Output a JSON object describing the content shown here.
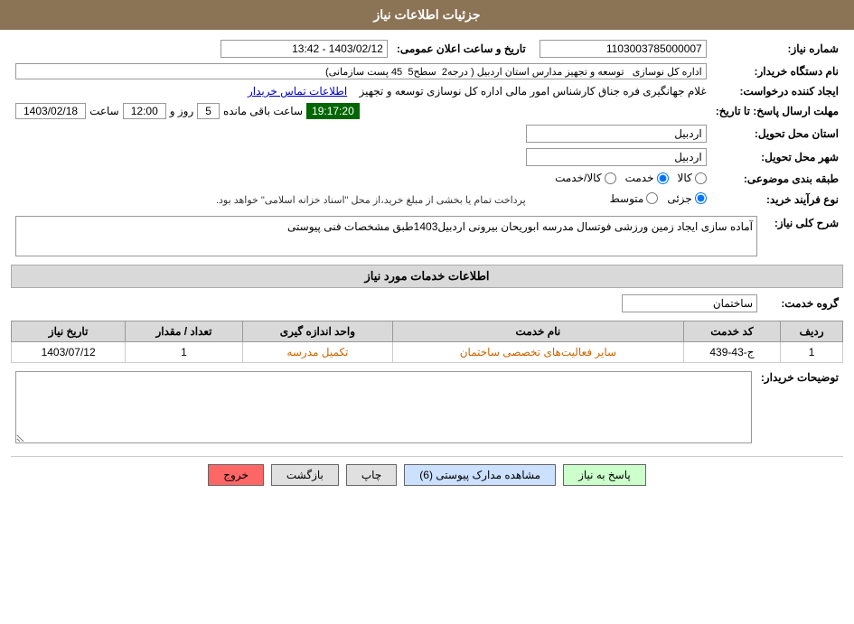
{
  "header": {
    "title": "جزئیات اطلاعات نیاز"
  },
  "fields": {
    "need_number_label": "شماره نیاز:",
    "need_number_value": "1103003785000007",
    "buyer_name_label": "نام دستگاه خریدار:",
    "buyer_name_value": "اداره کل نوسازی   توسعه و تجهیز مدارس استان اردبیل ( درجه2  سطح5  45 پست سازمانی)",
    "date_time_label": "تاریخ و ساعت اعلان عمومی:",
    "date_time_value": "1403/02/12 - 13:42",
    "requester_label": "ایجاد کننده درخواست:",
    "requester_value": "غلام جهانگیری فره جناق کارشناس امور مالی اداره کل نوسازی   توسعه و تجهیز",
    "contact_link": "اطلاعات تماس خریدار",
    "deadline_label": "مهلت ارسال پاسخ: تا تاریخ:",
    "deadline_date": "1403/02/18",
    "deadline_time_label": "ساعت",
    "deadline_time": "12:00",
    "deadline_day_label": "روز و",
    "deadline_days": "5",
    "deadline_remaining_label": "ساعت باقی مانده",
    "deadline_remaining": "19:17:20",
    "province_label": "استان محل تحویل:",
    "province_value": "اردبیل",
    "city_label": "شهر محل تحویل:",
    "city_value": "اردبیل",
    "category_label": "طبقه بندی موضوعی:",
    "category_options": [
      "کالا",
      "خدمت",
      "کالا/خدمت"
    ],
    "category_selected": "خدمت",
    "purchase_type_label": "نوع فرآیند خرید:",
    "purchase_options": [
      "جزئی",
      "متوسط"
    ],
    "purchase_selected": "جزئی",
    "payment_notice": "پرداخت تمام یا بخشی از مبلغ خرید،از محل \"اسناد خزانه اسلامی\" خواهد بود.",
    "need_description_label": "شرح کلی نیاز:",
    "need_description_value": "آماده سازی ایجاد زمین ورزشی فوتسال مدرسه ابوریحان بیرونی اردبیل1403طبق مشخصات فنی پیوستی",
    "services_title": "اطلاعات خدمات مورد نیاز",
    "service_group_label": "گروه خدمت:",
    "service_group_value": "ساختمان",
    "table": {
      "columns": [
        "ردیف",
        "کد خدمت",
        "نام خدمت",
        "واحد اندازه گیری",
        "تعداد / مقدار",
        "تاریخ نیاز"
      ],
      "rows": [
        {
          "row_num": "1",
          "service_code": "ج-43-439",
          "service_name": "سایر فعالیت‌های تخصصی ساختمان",
          "unit": "تکمیل مدرسه",
          "quantity": "1",
          "date": "1403/07/12"
        }
      ]
    },
    "buyer_remarks_label": "توضیحات خریدار:",
    "buyer_remarks_value": ""
  },
  "buttons": {
    "respond": "پاسخ به نیاز",
    "view_docs": "مشاهده مدارک پیوستی (6)",
    "print": "چاپ",
    "back": "بازگشت",
    "exit": "خروج"
  }
}
